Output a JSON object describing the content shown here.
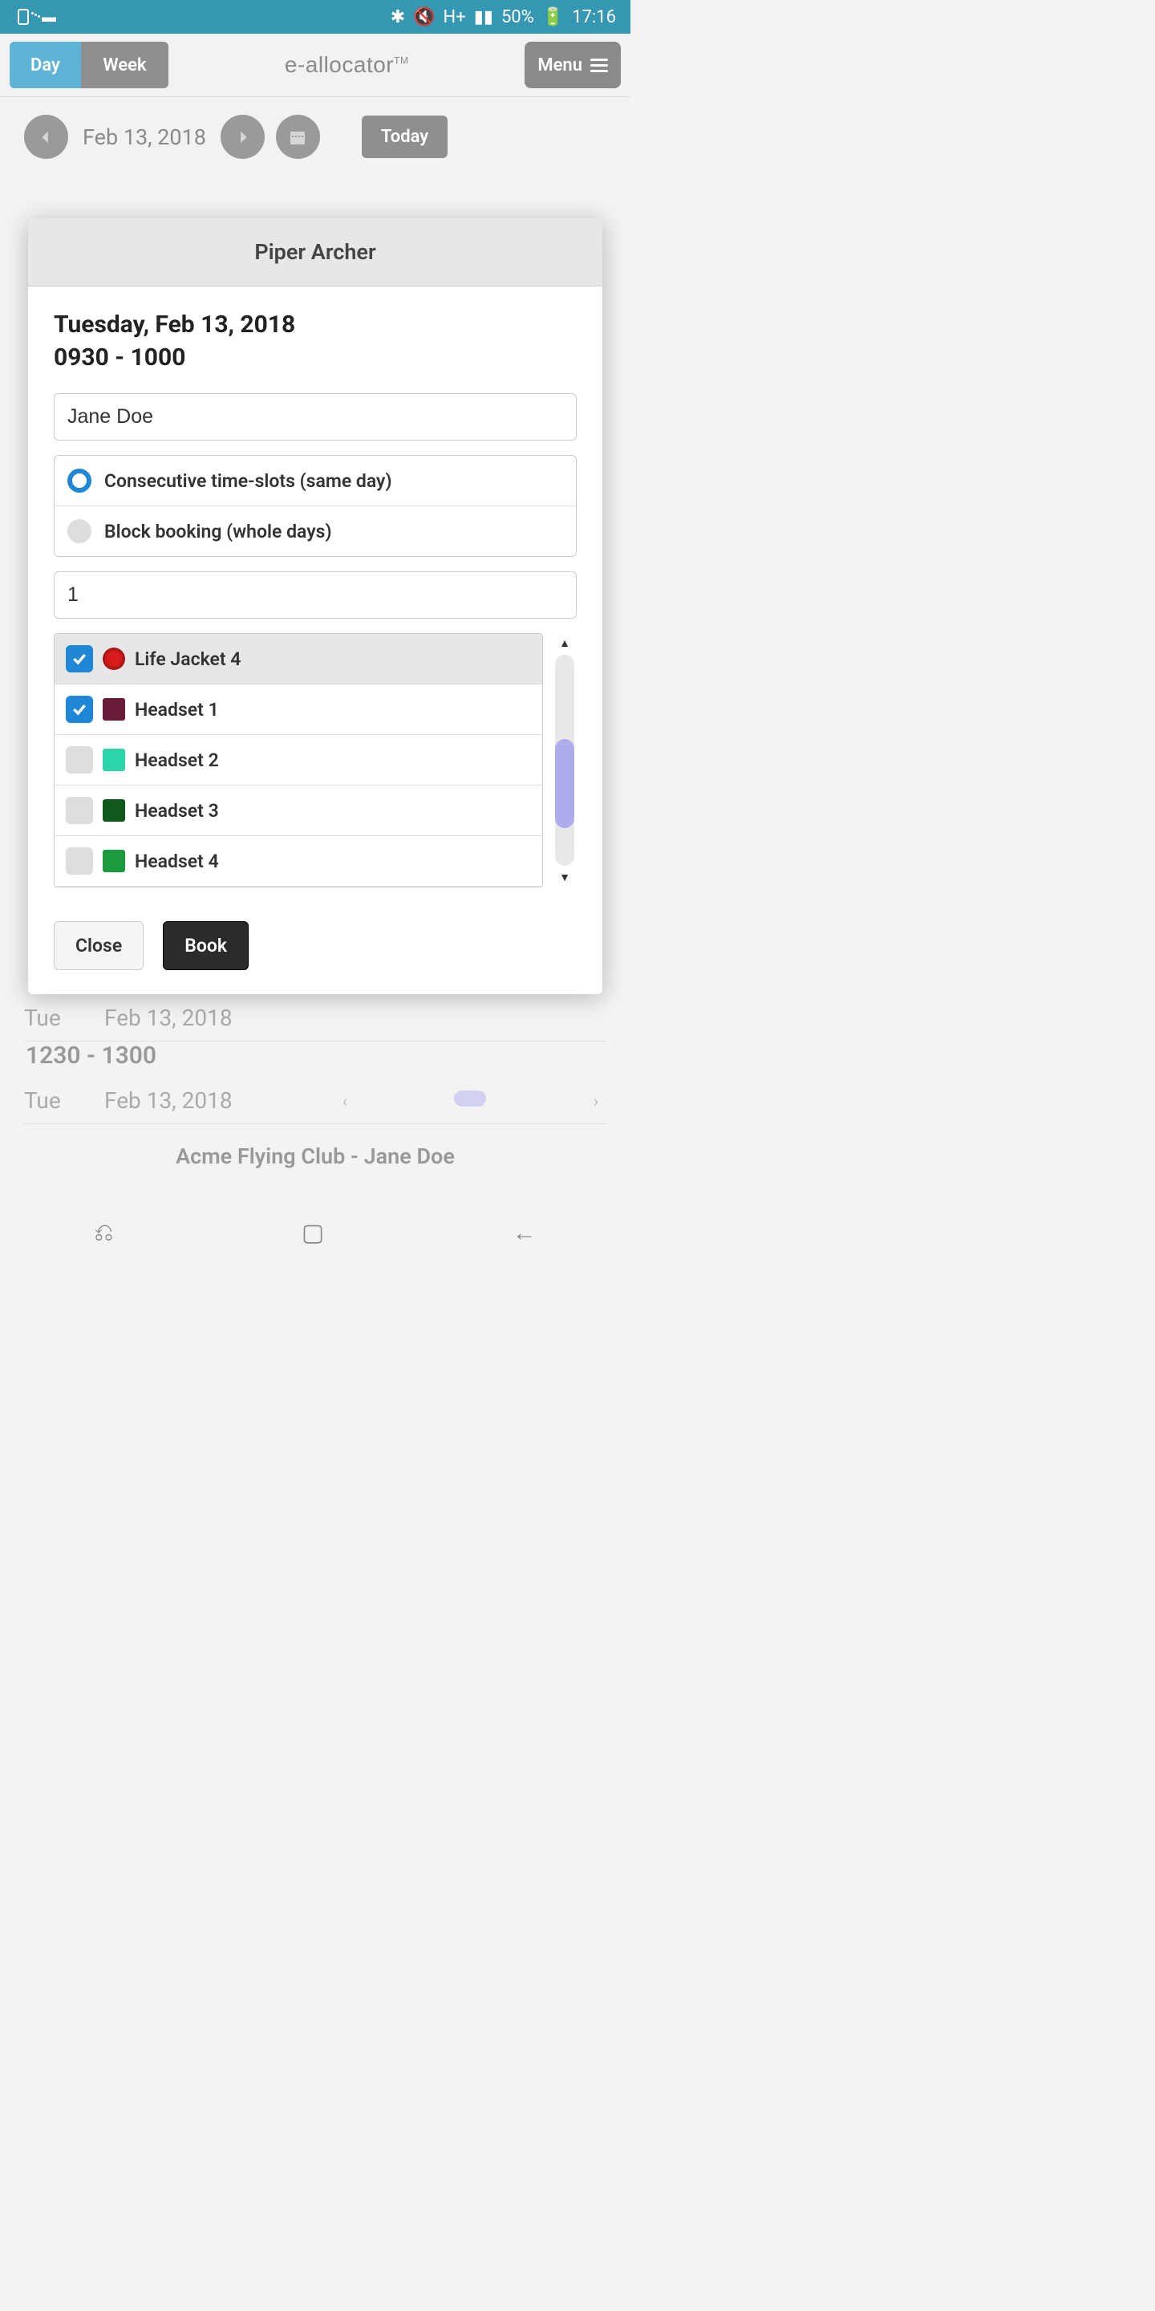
{
  "status_bar": {
    "battery_pct": "50%",
    "time": "17:16"
  },
  "header": {
    "toggle_day": "Day",
    "toggle_week": "Week",
    "logo": "e-allocator",
    "logo_tm": "TM",
    "menu": "Menu"
  },
  "nav": {
    "date": "Feb 13, 2018",
    "today": "Today"
  },
  "modal": {
    "title": "Piper Archer",
    "date_line": "Tuesday, Feb 13, 2018",
    "time_line": "0930 - 1000",
    "user_value": "Jane Doe",
    "radio_consecutive": "Consecutive time-slots (same day)",
    "radio_block": "Block booking (whole days)",
    "quantity_value": "1",
    "items": [
      {
        "label": "Life Jacket 4",
        "checked": true,
        "swatch": "red",
        "highlighted": true
      },
      {
        "label": "Headset 1",
        "checked": true,
        "swatch": "maroon",
        "highlighted": false
      },
      {
        "label": "Headset 2",
        "checked": false,
        "swatch": "teal",
        "highlighted": false
      },
      {
        "label": "Headset 3",
        "checked": false,
        "swatch": "darkgreen",
        "highlighted": false
      },
      {
        "label": "Headset 4",
        "checked": false,
        "swatch": "green",
        "highlighted": false
      }
    ],
    "close": "Close",
    "book": "Book"
  },
  "background": {
    "row1_day": "Tue",
    "row1_date": "Feb 13, 2018",
    "row1_time": "1230 - 1300",
    "row2_day": "Tue",
    "row2_date": "Feb 13, 2018"
  },
  "footer": "Acme Flying Club - Jane Doe"
}
